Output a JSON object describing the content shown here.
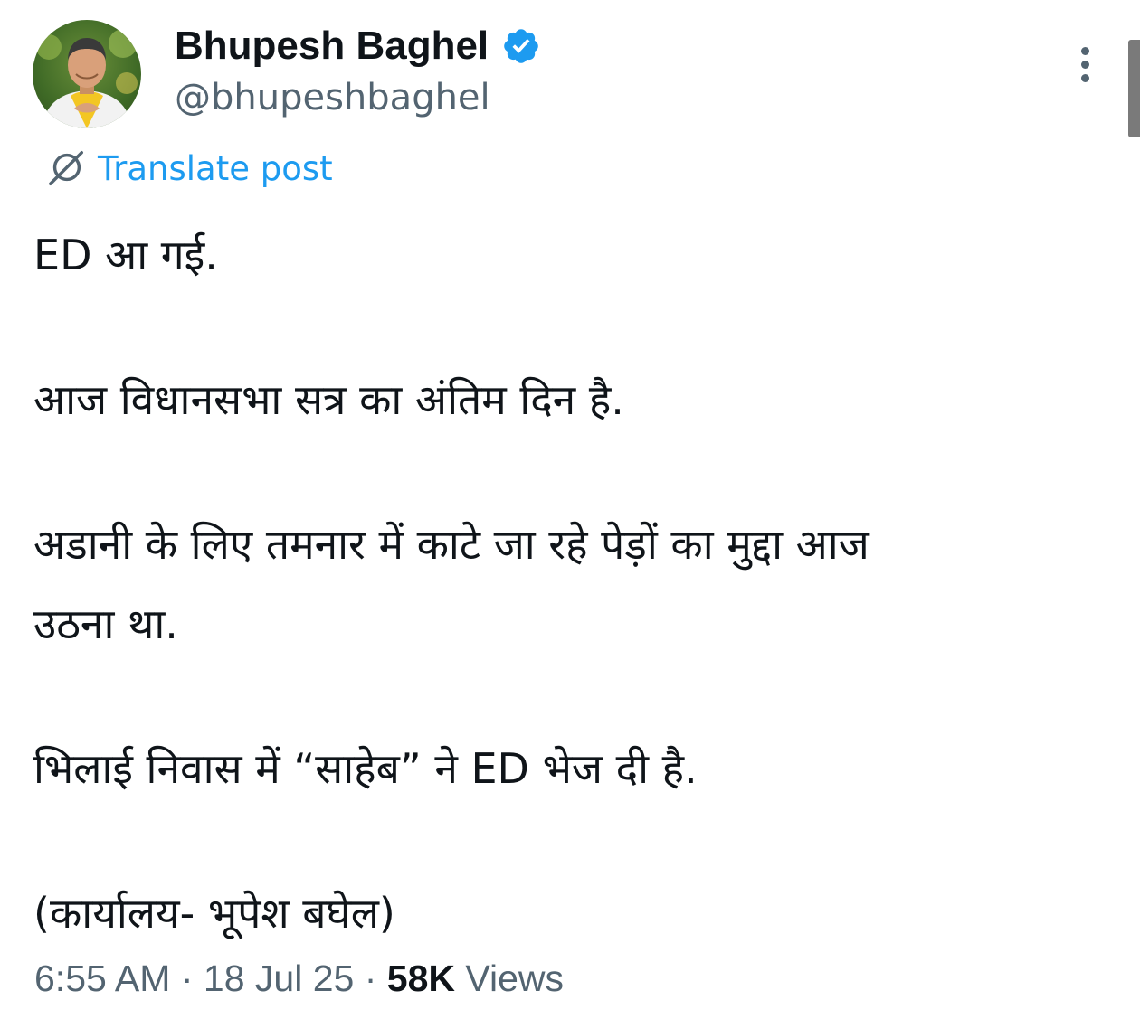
{
  "author": {
    "display_name": "Bhupesh Baghel",
    "handle": "@bhupeshbaghel",
    "verified": true
  },
  "translate": {
    "label": "Translate post"
  },
  "tweet": {
    "lines": [
      "ED आ गई.",
      "आज विधानसभा सत्र का अंतिम दिन है.",
      "अडानी के लिए तमनार में काटे जा रहे पेड़ों का मुद्दा आज",
      "उठना था.",
      "भिलाई निवास में “साहेब” ने ED भेज दी है.",
      "(कार्यालय- भूपेश बघेल)"
    ]
  },
  "meta": {
    "time": "6:55 AM",
    "separator": "·",
    "date": "18 Jul 25",
    "views_count": "58K",
    "views_label": "Views"
  },
  "icons": {
    "verified": "verified-badge-icon",
    "more": "more-vertical-icon",
    "translate": "translate-globe-icon"
  },
  "colors": {
    "accent": "#1d9bf0",
    "text_primary": "#0f1419",
    "text_secondary": "#536471",
    "background": "#ffffff"
  }
}
